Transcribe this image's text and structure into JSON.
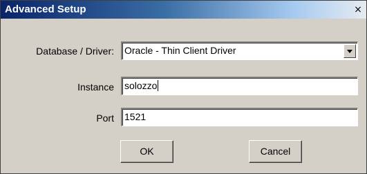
{
  "window": {
    "title": "Advanced Setup",
    "close_icon": "×"
  },
  "form": {
    "database_label": "Database / Driver:",
    "database_value": "Oracle - Thin Client Driver",
    "instance_label": "Instance",
    "instance_value": "solozzo",
    "port_label": "Port",
    "port_value": "1521"
  },
  "buttons": {
    "ok": "OK",
    "cancel": "Cancel"
  }
}
